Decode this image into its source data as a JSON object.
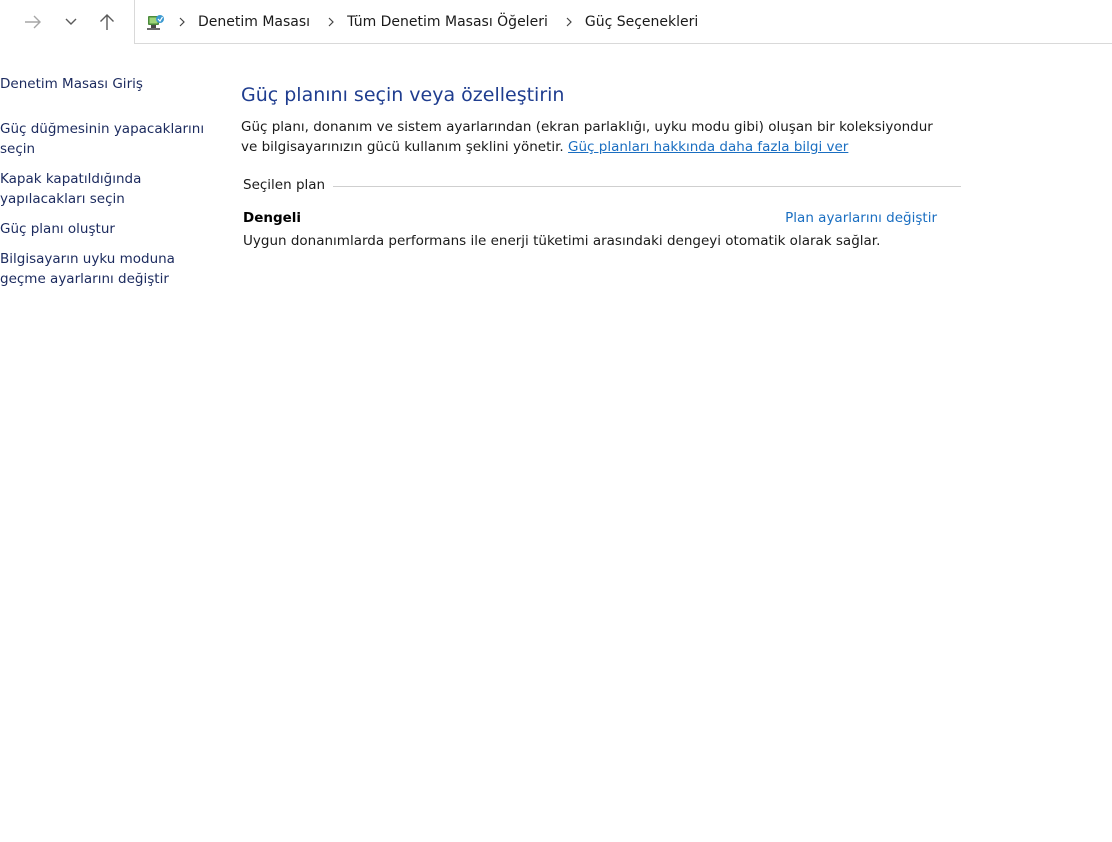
{
  "nav": {
    "back_icon": "arrow-right-icon",
    "recent_icon": "chevron-down-icon",
    "up_icon": "arrow-up-icon"
  },
  "address": {
    "icon": "control-panel-icon",
    "crumbs": [
      "Denetim Masası",
      "Tüm Denetim Masası Öğeleri",
      "Güç Seçenekleri"
    ]
  },
  "sidebar": {
    "home": "Denetim Masası Giriş",
    "items": [
      {
        "label": "Güç düğmesinin yapacaklarını seçin"
      },
      {
        "label": "Kapak kapatıldığında yapılacakları seçin"
      },
      {
        "label": "Güç planı oluştur"
      },
      {
        "label": "Bilgisayarın uyku moduna geçme ayarlarını değiştir"
      }
    ]
  },
  "main": {
    "title": "Güç planını seçin veya özelleştirin",
    "intro": "Güç planı, donanım ve sistem ayarlarından (ekran parlaklığı, uyku modu gibi) oluşan bir koleksiyondur ve bilgisayarınızın gücü kullanım şeklini yönetir.",
    "intro_link": "Güç planları hakkında daha fazla bilgi ver",
    "group_label": "Seçilen plan",
    "plan": {
      "name": "Dengeli",
      "settings_link": "Plan ayarlarını değiştir",
      "description": "Uygun donanımlarda performans ile enerji tüketimi arasındaki dengeyi otomatik olarak sağlar."
    }
  },
  "colors": {
    "title": "#1f3d8f",
    "link": "#1a6ec1",
    "sidebar_link": "#1b2a5e"
  }
}
